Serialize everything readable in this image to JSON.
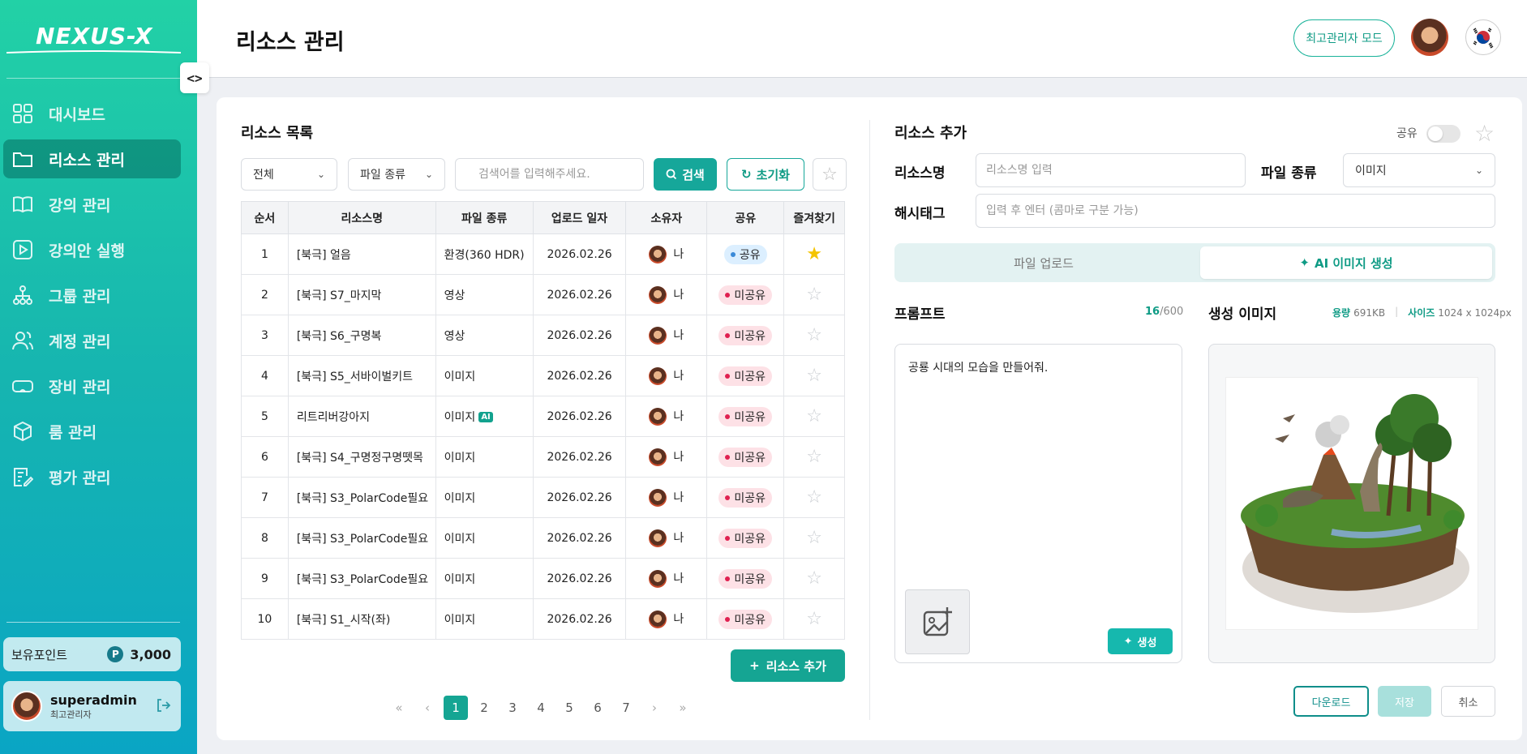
{
  "brand": {
    "logo_text": "NEXUS-X"
  },
  "sidebar": {
    "items": [
      {
        "label": "대시보드",
        "icon": "dashboard-icon",
        "active": false
      },
      {
        "label": "리소스 관리",
        "icon": "folder-icon",
        "active": true
      },
      {
        "label": "강의 관리",
        "icon": "book-icon",
        "active": false
      },
      {
        "label": "강의안 실행",
        "icon": "play-icon",
        "active": false
      },
      {
        "label": "그룹 관리",
        "icon": "org-icon",
        "active": false
      },
      {
        "label": "계정 관리",
        "icon": "users-icon",
        "active": false
      },
      {
        "label": "장비 관리",
        "icon": "vr-headset-icon",
        "active": false
      },
      {
        "label": "룸 관리",
        "icon": "cube-icon",
        "active": false
      },
      {
        "label": "평가 관리",
        "icon": "clipboard-edit-icon",
        "active": false
      }
    ],
    "points_label": "보유포인트",
    "points_badge": "P",
    "points_value": "3,000",
    "user_name": "superadmin",
    "user_role": "최고관리자"
  },
  "header": {
    "title": "리소스 관리",
    "mode_button": "최고관리자 모드"
  },
  "list": {
    "title": "리소스 목록",
    "filter_all": "전체",
    "filter_type": "파일 종류",
    "search_placeholder": "검색어를 입력해주세요.",
    "search_button": "검색",
    "reset_button": "초기화",
    "columns": [
      "순서",
      "리소스명",
      "파일 종류",
      "업로드 일자",
      "소유자",
      "공유",
      "즐겨찾기"
    ],
    "rows": [
      {
        "no": "1",
        "name": "[북극] 얼음",
        "type": "환경(360 HDR)",
        "ai": false,
        "date": "2026.02.26",
        "owner": "나",
        "share": "공유",
        "shared": true,
        "fav": true
      },
      {
        "no": "2",
        "name": "[북극] S7_마지막",
        "type": "영상",
        "ai": false,
        "date": "2026.02.26",
        "owner": "나",
        "share": "미공유",
        "shared": false,
        "fav": false
      },
      {
        "no": "3",
        "name": "[북극] S6_구명복",
        "type": "영상",
        "ai": false,
        "date": "2026.02.26",
        "owner": "나",
        "share": "미공유",
        "shared": false,
        "fav": false
      },
      {
        "no": "4",
        "name": "[북극] S5_서바이벌키트",
        "type": "이미지",
        "ai": false,
        "date": "2026.02.26",
        "owner": "나",
        "share": "미공유",
        "shared": false,
        "fav": false
      },
      {
        "no": "5",
        "name": "리트리버강아지",
        "type": "이미지",
        "ai": true,
        "date": "2026.02.26",
        "owner": "나",
        "share": "미공유",
        "shared": false,
        "fav": false
      },
      {
        "no": "6",
        "name": "[북극] S4_구명정구명뗏목",
        "type": "이미지",
        "ai": false,
        "date": "2026.02.26",
        "owner": "나",
        "share": "미공유",
        "shared": false,
        "fav": false
      },
      {
        "no": "7",
        "name": "[북극] S3_PolarCode필요",
        "type": "이미지",
        "ai": false,
        "date": "2026.02.26",
        "owner": "나",
        "share": "미공유",
        "shared": false,
        "fav": false
      },
      {
        "no": "8",
        "name": "[북극] S3_PolarCode필요",
        "type": "이미지",
        "ai": false,
        "date": "2026.02.26",
        "owner": "나",
        "share": "미공유",
        "shared": false,
        "fav": false
      },
      {
        "no": "9",
        "name": "[북극] S3_PolarCode필요",
        "type": "이미지",
        "ai": false,
        "date": "2026.02.26",
        "owner": "나",
        "share": "미공유",
        "shared": false,
        "fav": false
      },
      {
        "no": "10",
        "name": "[북극] S1_시작(좌)",
        "type": "이미지",
        "ai": false,
        "date": "2026.02.26",
        "owner": "나",
        "share": "미공유",
        "shared": false,
        "fav": false
      }
    ],
    "ai_tag": "AI",
    "add_button": "리소스 추가",
    "pages": [
      "1",
      "2",
      "3",
      "4",
      "5",
      "6",
      "7"
    ],
    "current_page": "1"
  },
  "form": {
    "title": "리소스 추가",
    "share_label": "공유",
    "name_label": "리소스명",
    "name_placeholder": "리소스명 입력",
    "type_label": "파일 종류",
    "type_value": "이미지",
    "tag_label": "해시태그",
    "tag_placeholder": "입력 후 엔터 (콤마로 구분 가능)",
    "tab_upload": "파일 업로드",
    "tab_ai": "AI 이미지 생성",
    "prompt_label": "프롬프트",
    "prompt_count": "16",
    "prompt_max": "/600",
    "prompt_text": "공룡 시대의 모습을 만들어줘.",
    "generate_button": "생성",
    "gen_label": "생성 이미지",
    "size_label": "용량",
    "size_value": "691KB",
    "dim_label": "사이즈",
    "dim_value": "1024 x 1024px",
    "download_button": "다운로드",
    "save_button": "저장",
    "cancel_button": "취소"
  },
  "colors": {
    "accent": "#15a593",
    "sidebar_top": "#22d1a6",
    "sidebar_bottom": "#0aa5c4"
  }
}
